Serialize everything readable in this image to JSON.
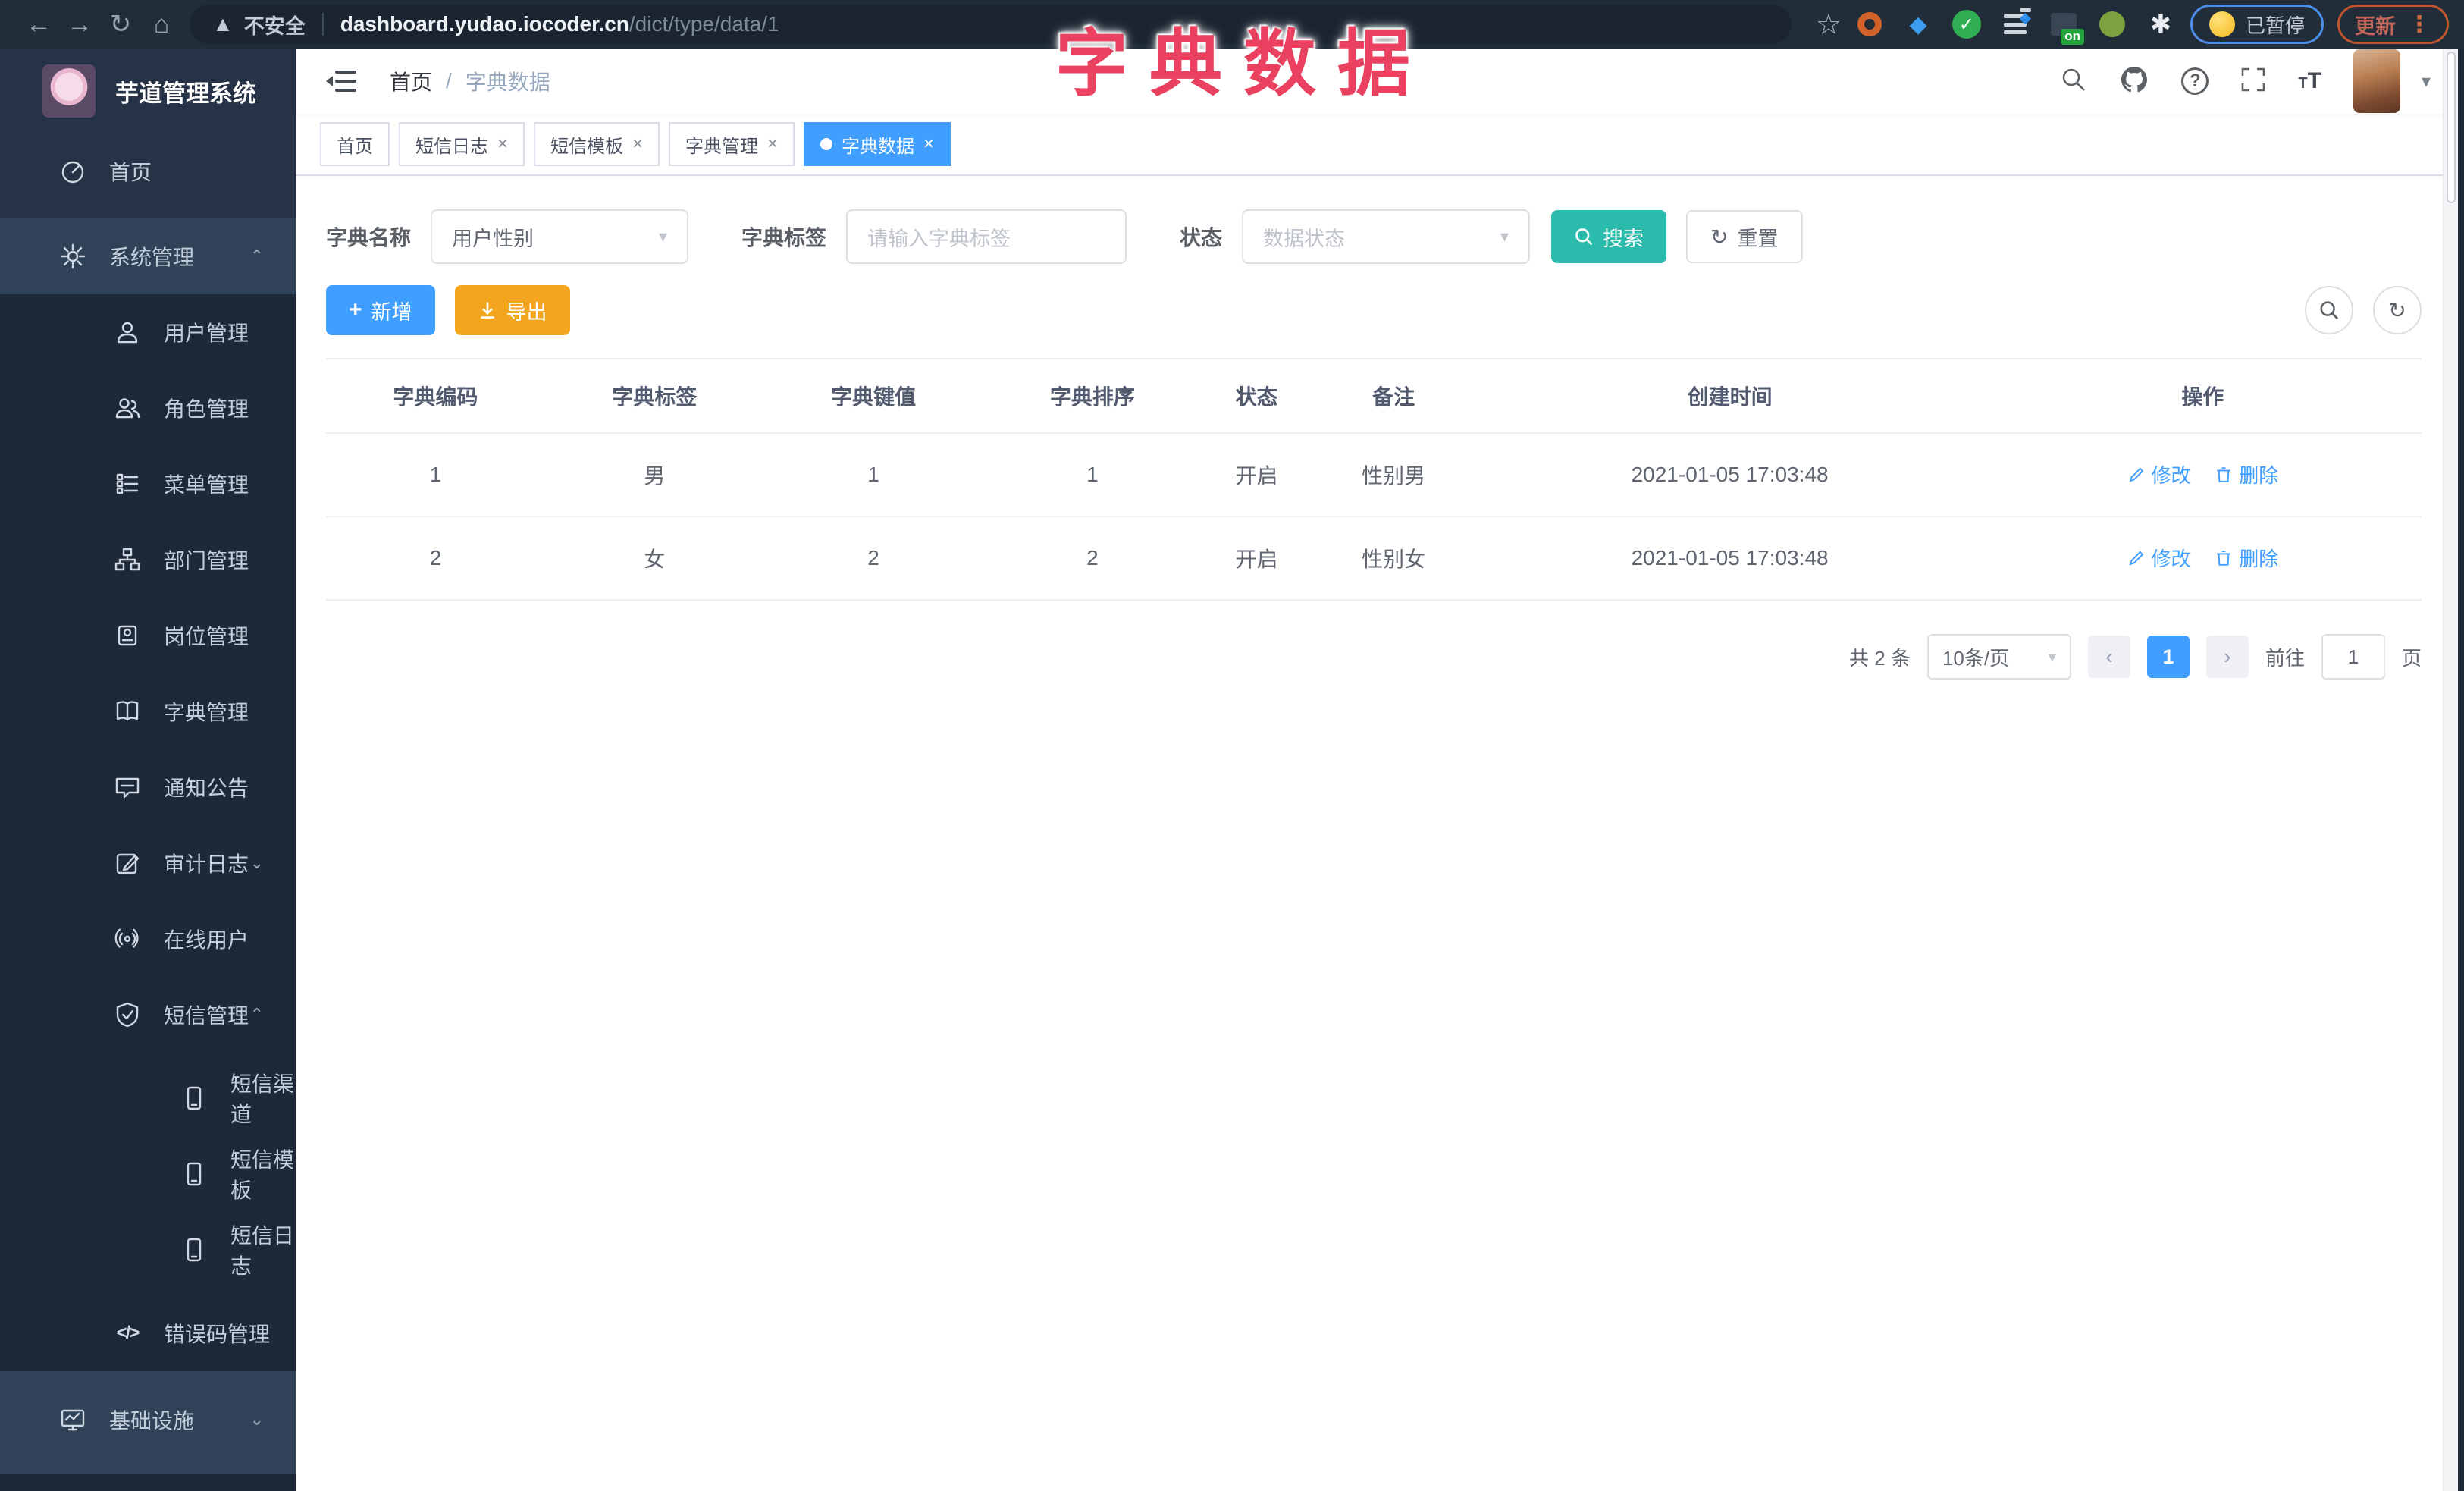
{
  "browser": {
    "security_label": "不安全",
    "url_host": "dashboard.yudao.iocoder.cn",
    "url_path": "/dict/type/data/1",
    "ext_on_badge": "on",
    "paused_label": "已暂停",
    "update_label": "更新"
  },
  "overlay_title": "字典数据",
  "sidebar": {
    "logo_title": "芋道管理系统",
    "items": [
      {
        "label": "首页"
      },
      {
        "label": "系统管理"
      },
      {
        "label": "用户管理"
      },
      {
        "label": "角色管理"
      },
      {
        "label": "菜单管理"
      },
      {
        "label": "部门管理"
      },
      {
        "label": "岗位管理"
      },
      {
        "label": "字典管理"
      },
      {
        "label": "通知公告"
      },
      {
        "label": "审计日志"
      },
      {
        "label": "在线用户"
      },
      {
        "label": "短信管理"
      },
      {
        "label": "短信渠道"
      },
      {
        "label": "短信模板"
      },
      {
        "label": "短信日志"
      },
      {
        "label": "错误码管理"
      },
      {
        "label": "基础设施"
      }
    ]
  },
  "header": {
    "breadcrumb_home": "首页",
    "breadcrumb_sep": "/",
    "breadcrumb_current": "字典数据"
  },
  "tabs": [
    {
      "label": "首页"
    },
    {
      "label": "短信日志"
    },
    {
      "label": "短信模板"
    },
    {
      "label": "字典管理"
    },
    {
      "label": "字典数据"
    }
  ],
  "filters": {
    "name_label": "字典名称",
    "name_value": "用户性别",
    "tag_label": "字典标签",
    "tag_placeholder": "请输入字典标签",
    "status_label": "状态",
    "status_placeholder": "数据状态",
    "search_label": "搜索",
    "reset_label": "重置"
  },
  "toolbar": {
    "add_label": "新增",
    "export_label": "导出"
  },
  "table": {
    "columns": [
      "字典编码",
      "字典标签",
      "字典键值",
      "字典排序",
      "状态",
      "备注",
      "创建时间",
      "操作"
    ],
    "edit_label": "修改",
    "delete_label": "删除",
    "rows": [
      {
        "code": "1",
        "label": "男",
        "value": "1",
        "sort": "1",
        "status": "开启",
        "remark": "性别男",
        "created": "2021-01-05 17:03:48"
      },
      {
        "code": "2",
        "label": "女",
        "value": "2",
        "sort": "2",
        "status": "开启",
        "remark": "性别女",
        "created": "2021-01-05 17:03:48"
      }
    ]
  },
  "pagination": {
    "total": "共 2 条",
    "page_size": "10条/页",
    "current_page": "1",
    "goto_label": "前往",
    "goto_value": "1",
    "page_unit": "页"
  },
  "colors": {
    "accent_blue": "#409eff",
    "search_teal": "#2bbbad",
    "export_orange": "#f3a51f",
    "overlay_pink": "#e9415f",
    "sidebar_dark": "#1d2938"
  }
}
